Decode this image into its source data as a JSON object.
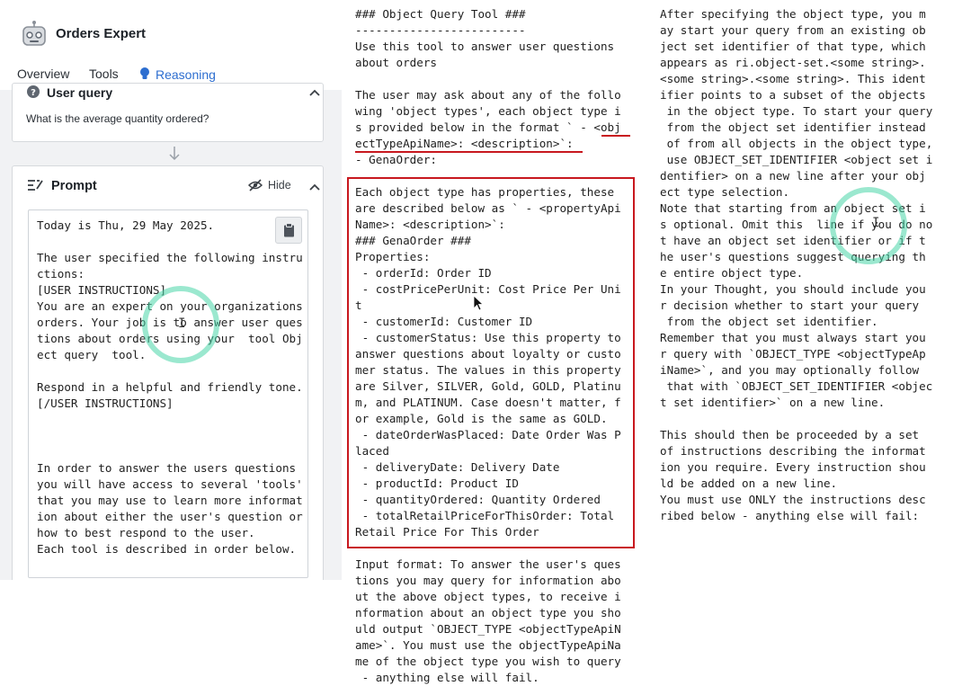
{
  "app": {
    "title": "Orders Expert"
  },
  "tabs": [
    {
      "label": "Overview",
      "active": false
    },
    {
      "label": "Tools",
      "active": false
    },
    {
      "label": "Reasoning",
      "active": true
    }
  ],
  "user_query": {
    "title": "User query",
    "text": "What is the average quantity ordered?"
  },
  "prompt": {
    "title": "Prompt",
    "hide_label": "Hide",
    "lines": [
      "Today is Thu, 29 May 2025.",
      "",
      "The user specified the following instru",
      "ctions:",
      "[USER INSTRUCTIONS]",
      "You are an expert on your organizations",
      "orders. Your job is to answer user ques",
      "tions about orders using your  tool Obj",
      "ect query  tool.",
      "",
      "Respond in a helpful and friendly tone.",
      "[/USER INSTRUCTIONS]",
      "",
      "",
      "",
      "In order to answer the users questions",
      "you will have access to several 'tools'",
      "that you may use to learn more informat",
      "ion about either the user's question or",
      "how to best respond to the user.",
      "Each tool is described in order below."
    ]
  },
  "middle": {
    "lines": [
      "### Object Query Tool ###",
      "-------------------------",
      "Use this tool to answer user questions",
      "about orders",
      "",
      "The user may ask about any of the follo",
      "wing 'object types', each object type i",
      "s provided below in the format ` - <obj",
      "ectTypeApiName>: <description>`:",
      "- GenaOrder:",
      "",
      "Each object type has properties, these",
      "are described below as ` - <propertyApi",
      "Name>: <description>`:",
      "### GenaOrder ###",
      "Properties:",
      " - orderId: Order ID",
      " - costPricePerUnit: Cost Price Per Uni",
      "t",
      " - customerId: Customer ID",
      " - customerStatus: Use this property to",
      "answer questions about loyalty or custo",
      "mer status. The values in this property",
      "are Silver, SILVER, Gold, GOLD, Platinu",
      "m, and PLATINUM. Case doesn't matter, f",
      "or example, Gold is the same as GOLD.",
      " - dateOrderWasPlaced: Date Order Was P",
      "laced",
      " - deliveryDate: Delivery Date",
      " - productId: Product ID",
      " - quantityOrdered: Quantity Ordered",
      " - totalRetailPriceForThisOrder: Total",
      "Retail Price For This Order",
      "",
      "Input format: To answer the user's ques",
      "tions you may query for information abo",
      "ut the above object types, to receive i",
      "nformation about an object type you sho",
      "uld output `OBJECT_TYPE <objectTypeApiN",
      "ame>`. You must use the objectTypeApiNa",
      "me of the object type you wish to query",
      " - anything else will fail."
    ]
  },
  "right": {
    "lines": [
      "After specifying the object type, you m",
      "ay start your query from an existing ob",
      "ject set identifier of that type, which",
      "appears as ri.object-set.<some string>.",
      "<some string>.<some string>. This ident",
      "ifier points to a subset of the objects",
      " in the object type. To start your query",
      " from the object set identifier instead",
      " of from all objects in the object type,",
      " use OBJECT_SET_IDENTIFIER <object set i",
      "dentifier> on a new line after your obj",
      "ect type selection.",
      "Note that starting from an object set i",
      "s optional. Omit this  line if you do no",
      "t have an object set identifier or if t",
      "he user's questions suggest querying th",
      "e entire object type.",
      "In your Thought, you should include you",
      "r decision whether to start your query",
      " from the object set identifier.",
      "Remember that you must always start you",
      "r query with `OBJECT_TYPE <objectTypeAp",
      "iName>`, and you may optionally follow",
      " that with `OBJECT_SET_IDENTIFIER <objec",
      "t set identifier>` on a new line.",
      "",
      "This should then be proceeded by a set",
      "of instructions describing the informat",
      "ion you require. Every instruction shou",
      "ld be added on a new line.",
      "You must use ONLY the instructions desc",
      "ribed below - anything else will fail:"
    ]
  },
  "colors": {
    "accent": "#2d6ed0",
    "highlight": "#c8181f",
    "cursor_ring": "#48d6a8"
  }
}
